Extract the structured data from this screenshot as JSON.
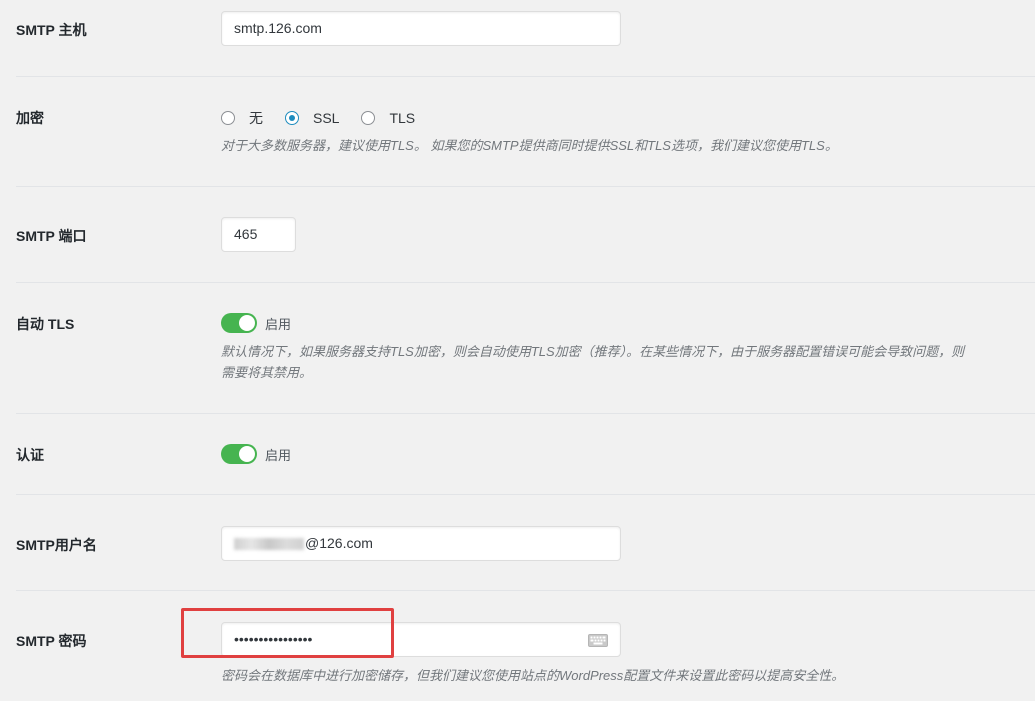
{
  "smtp_host": {
    "label": "SMTP 主机",
    "value": "smtp.126.com"
  },
  "encryption": {
    "label": "加密",
    "options": [
      {
        "label": "无",
        "checked": false
      },
      {
        "label": "SSL",
        "checked": true
      },
      {
        "label": "TLS",
        "checked": false
      }
    ],
    "description": "对于大多数服务器，建议使用TLS。 如果您的SMTP提供商同时提供SSL和TLS选项，我们建议您使用TLS。"
  },
  "smtp_port": {
    "label": "SMTP 端口",
    "value": "465"
  },
  "auto_tls": {
    "label": "自动 TLS",
    "toggle_label": "启用",
    "enabled": true,
    "description_line1": "默认情况下，如果服务器支持TLS加密，则会自动使用TLS加密（推荐）。在某些情况下，由于服务器配置错误可能会导致问题，则",
    "description_line2": "需要将其禁用。"
  },
  "auth": {
    "label": "认证",
    "toggle_label": "启用",
    "enabled": true
  },
  "smtp_username": {
    "label": "SMTP用户名",
    "value_suffix": "@126.com"
  },
  "smtp_password": {
    "label": "SMTP 密码",
    "value": "••••••••••••••••",
    "description": "密码会在数据库中进行加密储存，但我们建议您使用站点的WordPress配置文件来设置此密码以提高安全性。"
  },
  "colors": {
    "toggle_on": "#46b450",
    "radio_checked": "#1e8cbe",
    "highlight": "#e04040"
  },
  "icons": {
    "password_field": "keyboard-icon"
  }
}
